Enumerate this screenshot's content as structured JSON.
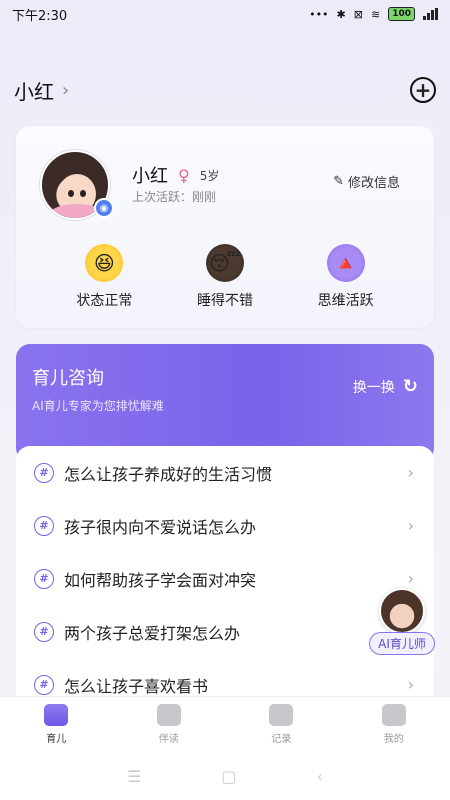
{
  "status_bar": {
    "time": "下午2:30",
    "battery": "100"
  },
  "header": {
    "child_selector": "小红"
  },
  "profile": {
    "name": "小红",
    "age": "5岁",
    "last_active": "上次活跃：刚刚",
    "edit_label": "修改信息",
    "statuses": [
      {
        "label": "状态正常",
        "icon": "happy-emoji-icon"
      },
      {
        "label": "睡得不错",
        "icon": "sleep-emoji-icon"
      },
      {
        "label": "思维活跃",
        "icon": "thinking-emoji-icon"
      }
    ]
  },
  "consult": {
    "title": "育儿咨询",
    "subtitle": "AI育儿专家为您排忧解难",
    "refresh_label": "换一换",
    "questions": [
      "怎么让孩子养成好的生活习惯",
      "孩子很内向不爱说话怎么办",
      "如何帮助孩子学会面对冲突",
      "两个孩子总爱打架怎么办",
      "怎么让孩子喜欢看书"
    ]
  },
  "ai_assistant": {
    "label": "AI育儿师"
  },
  "tabs": [
    {
      "label": "育儿",
      "active": true
    },
    {
      "label": "伴读",
      "active": false
    },
    {
      "label": "记录",
      "active": false
    },
    {
      "label": "我的",
      "active": false
    }
  ],
  "colors": {
    "accent": "#7a62ea",
    "female": "#e2679a"
  }
}
